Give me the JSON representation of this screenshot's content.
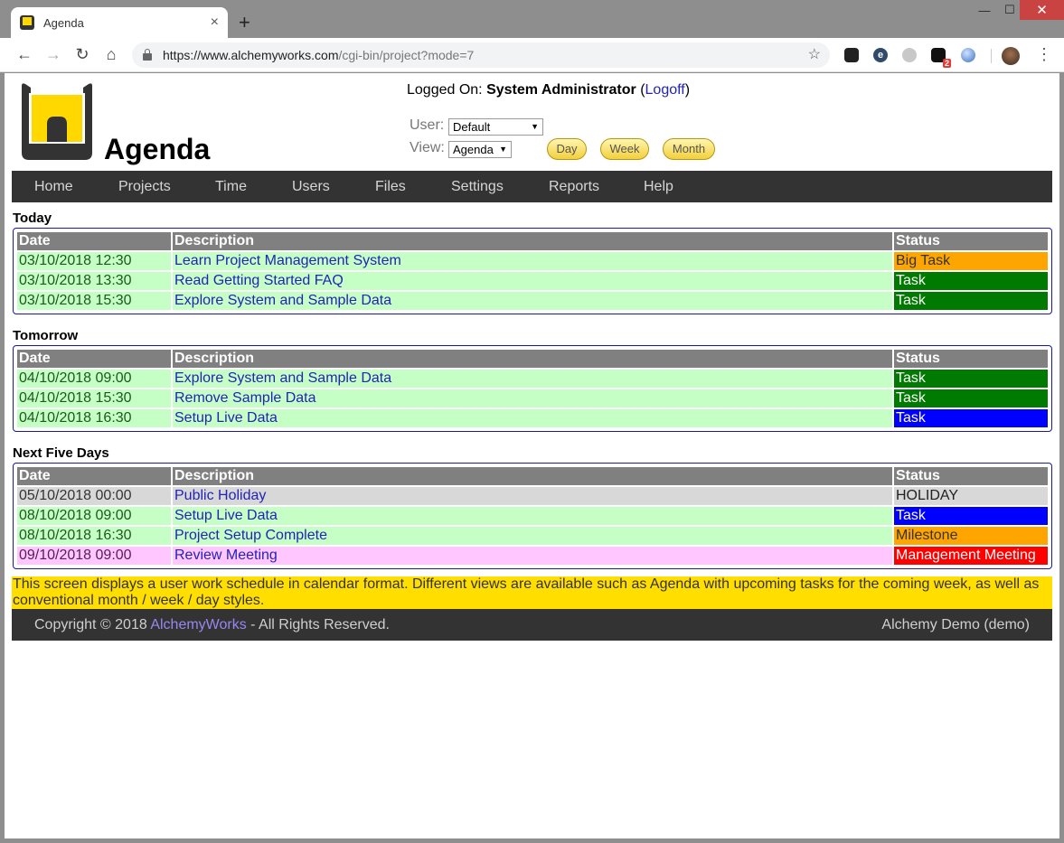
{
  "browser": {
    "tab_title": "Agenda",
    "tab_close": "×",
    "new_tab": "+",
    "url_host": "https://www.alchemyworks.com",
    "url_path": "/cgi-bin/project?mode=7",
    "back": "←",
    "forward": "→",
    "reload": "↻",
    "home": "⌂",
    "star": "☆",
    "menu": "⋮",
    "ext_badge_count": "2",
    "minimize": "—",
    "maximize": "☐",
    "close": "✕"
  },
  "header": {
    "app_title": "Agenda",
    "logged_on_label": "Logged On:",
    "user_name": "System Administrator",
    "logoff_label": "Logoff",
    "user_label": "User:",
    "user_select": "Default",
    "view_label": "View:",
    "view_select": "Agenda",
    "buttons": {
      "day": "Day",
      "week": "Week",
      "month": "Month"
    },
    "brand_colors": {
      "yellow": "#ffd800",
      "dark": "#333333"
    }
  },
  "nav": {
    "items": [
      "Home",
      "Projects",
      "Time",
      "Users",
      "Files",
      "Settings",
      "Reports",
      "Help"
    ]
  },
  "columns": {
    "date": "Date",
    "description": "Description",
    "status": "Status"
  },
  "sections": [
    {
      "title": "Today",
      "rows": [
        {
          "date": "03/10/2018 12:30",
          "description": "Learn Project Management System",
          "status": "Big Task",
          "row_color": "#c6ffc6",
          "status_color": "#ffa500",
          "status_text_color": "#333333"
        },
        {
          "date": "03/10/2018 13:30",
          "description": "Read Getting Started FAQ",
          "status": "Task",
          "row_color": "#c6ffc6",
          "status_color": "#007a00",
          "status_text_color": "#ffffff"
        },
        {
          "date": "03/10/2018 15:30",
          "description": "Explore System and Sample Data",
          "status": "Task",
          "row_color": "#c6ffc6",
          "status_color": "#007a00",
          "status_text_color": "#ffffff"
        }
      ]
    },
    {
      "title": "Tomorrow",
      "rows": [
        {
          "date": "04/10/2018 09:00",
          "description": "Explore System and Sample Data",
          "status": "Task",
          "row_color": "#c6ffc6",
          "status_color": "#007a00",
          "status_text_color": "#ffffff"
        },
        {
          "date": "04/10/2018 15:30",
          "description": "Remove Sample Data",
          "status": "Task",
          "row_color": "#c6ffc6",
          "status_color": "#007a00",
          "status_text_color": "#ffffff"
        },
        {
          "date": "04/10/2018 16:30",
          "description": "Setup Live Data",
          "status": "Task",
          "row_color": "#c6ffc6",
          "status_color": "#0000ff",
          "status_text_color": "#ffffff"
        }
      ]
    },
    {
      "title": "Next Five Days",
      "rows": [
        {
          "date": "05/10/2018 00:00",
          "description": "Public Holiday",
          "status": "HOLIDAY",
          "row_color": "#d8d8d8",
          "status_color": "#d8d8d8",
          "status_text_color": "#222222"
        },
        {
          "date": "08/10/2018 09:00",
          "description": "Setup Live Data",
          "status": "Task",
          "row_color": "#c6ffc6",
          "status_color": "#0000ff",
          "status_text_color": "#ffffff"
        },
        {
          "date": "08/10/2018 16:30",
          "description": "Project Setup Complete",
          "status": "Milestone",
          "row_color": "#c6ffc6",
          "status_color": "#ffa500",
          "status_text_color": "#333333"
        },
        {
          "date": "09/10/2018 09:00",
          "description": "Review Meeting",
          "status": "Management Meeting",
          "row_color": "#ffc6ff",
          "status_color": "#ff0000",
          "status_text_color": "#ffffff"
        }
      ]
    }
  ],
  "note": "This screen displays a user work schedule in calendar format. Different views are available such as Agenda with upcoming tasks for the coming week, as well as conventional month / week / day styles.",
  "footer": {
    "copyright_prefix": "Copyright © 2018 ",
    "company": "AlchemyWorks",
    "copyright_suffix": " - All Rights Reserved.",
    "instance": "Alchemy Demo (demo)"
  }
}
